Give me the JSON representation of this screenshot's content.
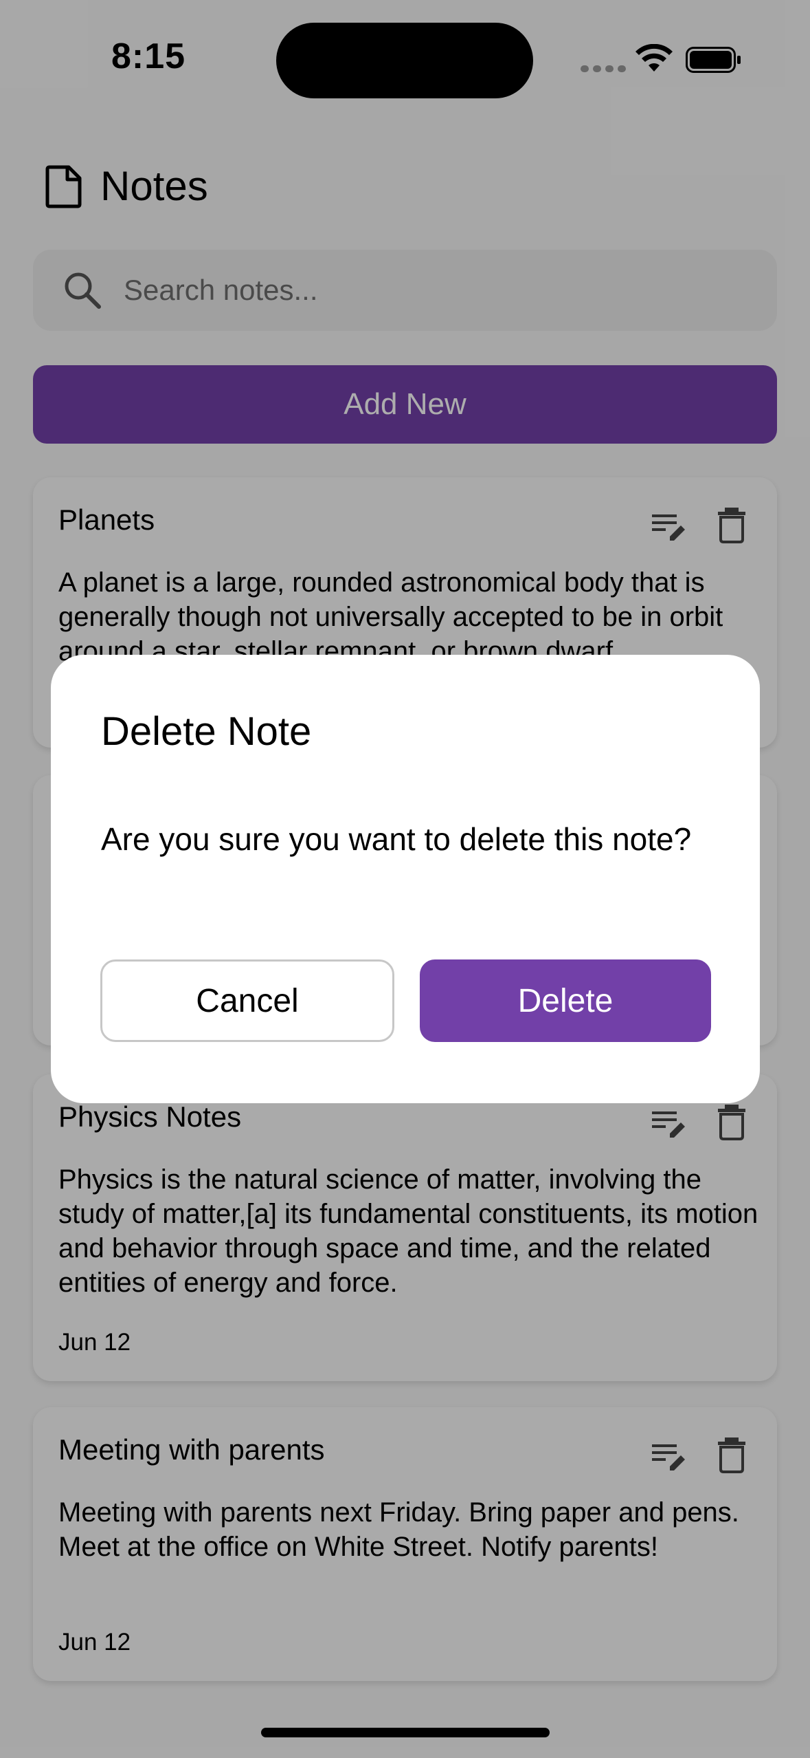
{
  "status_bar": {
    "time": "8:15"
  },
  "header": {
    "title": "Notes",
    "icon": "document-icon"
  },
  "search": {
    "placeholder": "Search notes..."
  },
  "add_button": {
    "label": "Add New"
  },
  "notes": [
    {
      "title": "Planets",
      "body": "A planet is a large, rounded astronomical body that is generally though not universally accepted to be in orbit around a star, stellar remnant, or brown dwarf",
      "date": ""
    },
    {
      "title": "",
      "body": "",
      "date": ""
    },
    {
      "title": "Physics Notes",
      "body": "Physics is the natural science of matter, involving the study of matter,[a] its fundamental constituents, its motion and behavior through space and time, and the related entities of energy and force.",
      "date": "Jun 12"
    },
    {
      "title": "Meeting with parents",
      "body": "Meeting with parents next Friday. Bring paper and pens. Meet at the office on White Street. Notify parents!",
      "date": "Jun 12"
    }
  ],
  "dialog": {
    "title": "Delete Note",
    "message": "Are you sure you want to delete this note?",
    "cancel_label": "Cancel",
    "confirm_label": "Delete"
  },
  "colors": {
    "accent": "#7240a8",
    "background": "#f7f7f7",
    "overlay": "rgba(0,0,0,0.32)"
  }
}
